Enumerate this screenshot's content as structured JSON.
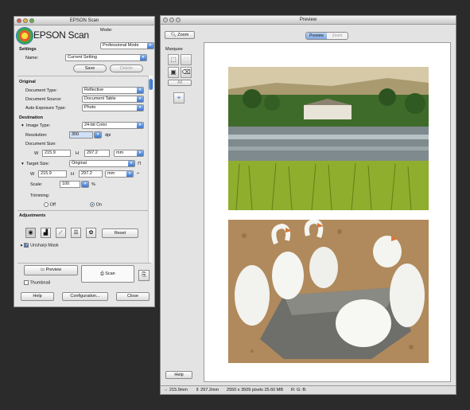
{
  "scan_window": {
    "title": "EPSON Scan",
    "logo_text": "EPSON Scan",
    "mode_label": "Mode:",
    "mode_value": "Professional Mode",
    "settings": {
      "heading": "Settings",
      "name_label": "Name:",
      "name_value": "Current Setting",
      "save": "Save",
      "delete": "Delete"
    },
    "original": {
      "heading": "Original",
      "document_type_label": "Document Type:",
      "document_type": "Reflective",
      "document_source_label": "Document Source:",
      "document_source": "Document Table",
      "auto_exposure_label": "Auto Exposure Type:",
      "auto_exposure": "Photo"
    },
    "destination": {
      "heading": "Destination",
      "image_type_label": "Image Type:",
      "image_type": "24-bit Color",
      "resolution_label": "Resolution:",
      "resolution": "300",
      "resolution_unit": "dpi",
      "document_size_label": "Document Size:",
      "w_label": "W",
      "w_value": "215.9",
      "h_label": "H",
      "h_value": "297.2",
      "unit": "mm"
    },
    "target": {
      "target_size_label": "Target Size:",
      "target_size": "Original",
      "w_label": "W",
      "w_value": "215.9",
      "h_label": "H",
      "h_value": "297.2",
      "unit": "mm",
      "scale_label": "Scale:",
      "scale_value": "100",
      "scale_unit": "%",
      "trimming_label": "Trimming:",
      "trim_off": "Off",
      "trim_on": "On"
    },
    "adjustments": {
      "heading": "Adjustments",
      "reset": "Reset",
      "unsharp_mask": "Unsharp Mask"
    },
    "preview_button": "Preview",
    "thumbnail": "Thumbnail",
    "scan_button": "Scan",
    "help": "Help",
    "configuration": "Configuration...",
    "close": "Close"
  },
  "preview_window": {
    "title": "Preview",
    "zoom_button": "Zoom",
    "tab_preview": "Preview",
    "tab_zoom": "Zoom",
    "marquee_label": "Marquee",
    "all_button": "All",
    "help": "Help",
    "status": {
      "width": "215.9mm",
      "height": "297.2mm",
      "pixels": "2550 x 3509 pixels 25.60 MB",
      "rgb": "R: G: B:"
    }
  },
  "colors": {
    "accent_blue": "#3d78cf",
    "background": "#2b2b2b"
  }
}
